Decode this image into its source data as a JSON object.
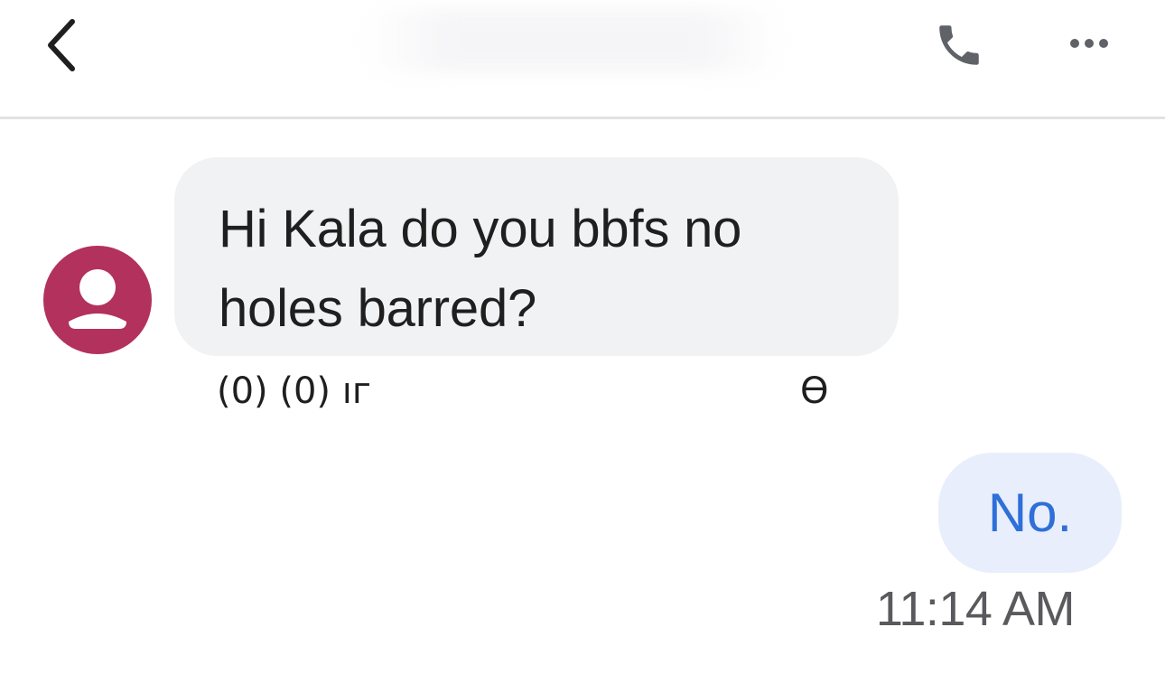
{
  "header": {
    "back_icon": "chevron-left-icon",
    "call_icon": "phone-icon",
    "more_icon": "more-horizontal-icon"
  },
  "messages": [
    {
      "direction": "incoming",
      "text": "Hi Kala do you bbfs no holes barred?",
      "meta": "(0) (0) ıг",
      "meta_tail": "Ө",
      "avatar_icon": "person-icon",
      "avatar_color": "#b3315d"
    },
    {
      "direction": "outgoing",
      "text": "No.",
      "timestamp": "11:14 AM"
    }
  ],
  "colors": {
    "incoming_bubble": "#f1f2f4",
    "outgoing_bubble": "#e8eefb",
    "outgoing_text": "#2f6fd8",
    "avatar": "#b3315d"
  }
}
